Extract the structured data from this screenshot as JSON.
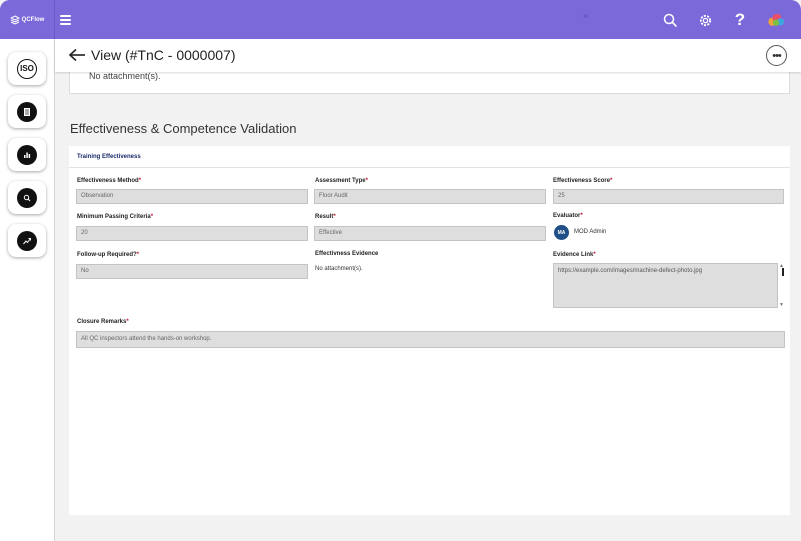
{
  "app": {
    "brand": "QCFlow",
    "top_mark": "×"
  },
  "colors": {
    "topbar": "#7b68d9",
    "required": "#c0152f",
    "avatar": "#1f4f86"
  },
  "header": {
    "title": "View (#TnC - 0000007)"
  },
  "sidebar": {
    "items": [
      {
        "icon": "iso-icon",
        "label": "ISO"
      },
      {
        "icon": "document-icon"
      },
      {
        "icon": "bar-chart-icon"
      },
      {
        "icon": "search-icon"
      },
      {
        "icon": "trend-icon"
      }
    ]
  },
  "attachments": {
    "text": "No attachment(s)."
  },
  "section": {
    "title": "Effectiveness & Competence Validation",
    "subtitle": "Training Effectiveness"
  },
  "form": {
    "effectiveness_method": {
      "label": "Effectiveness Method",
      "value": "Observation"
    },
    "assessment_type": {
      "label": "Assessment Type",
      "value": "Floor Audit"
    },
    "effectiveness_score": {
      "label": "Effectiveness Score",
      "value": "25"
    },
    "minimum_passing": {
      "label": "Minimum Passing Criteria",
      "value": "20"
    },
    "result": {
      "label": "Result",
      "value": "Effective"
    },
    "evaluator": {
      "label": "Evaluator",
      "initials": "MA",
      "name": "MOD Admin"
    },
    "followup": {
      "label": "Follow-up Required?",
      "value": "No"
    },
    "evidence": {
      "label": "Effectivness Evidence",
      "value": "No attachment(s)."
    },
    "evidence_link": {
      "label": "Evidence Link",
      "value": "https://example.com/images/machine-defect-photo.jpg"
    },
    "closure_remarks": {
      "label": "Closure Remarks",
      "value": "All QC inspectors attend the hands-on workshop."
    }
  }
}
